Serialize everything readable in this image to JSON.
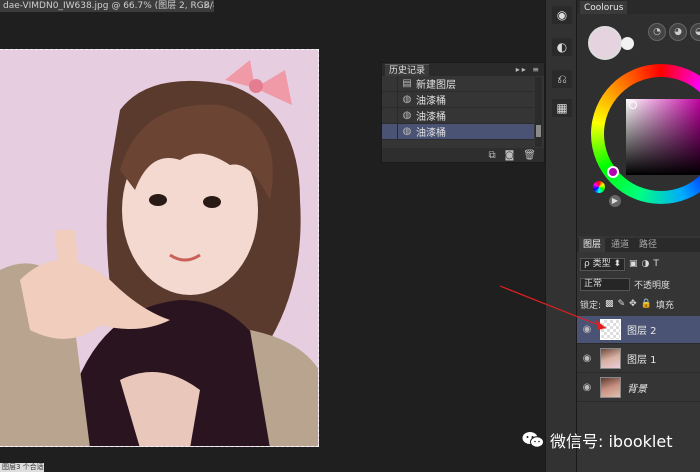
{
  "document_tab": {
    "title": "dae-VIMDN0_IW638.jpg @ 66.7% (图层 2, RGB/8*)",
    "close_icon": "close-icon"
  },
  "status_bar": {
    "text": "图层3 个合适"
  },
  "history_panel": {
    "tab_label": "历史记录",
    "items": [
      {
        "label": "新建图层",
        "icon": "document-icon"
      },
      {
        "label": "油漆桶",
        "icon": "paint-bucket-icon"
      },
      {
        "label": "油漆桶",
        "icon": "paint-bucket-icon"
      },
      {
        "label": "油漆桶",
        "icon": "paint-bucket-icon",
        "active": true
      }
    ]
  },
  "coolorus": {
    "tab_label": "Coolorus",
    "foreground_color": "#e6d3e0",
    "background_color": "#f2f2f2"
  },
  "layers_panel": {
    "tabs": [
      "图层",
      "通道",
      "路径"
    ],
    "filter_kind": "ρ 类型",
    "blend_mode": "正常",
    "opacity_label": "不透明度",
    "lock_label": "锁定:",
    "fill_label": "填充",
    "layers": [
      {
        "name": "图层 2",
        "active": true,
        "thumb": "transparent"
      },
      {
        "name": "图层 1",
        "active": false,
        "thumb": "photo"
      },
      {
        "name": "背景",
        "active": false,
        "thumb": "photo",
        "italic": true
      }
    ]
  },
  "watermark": {
    "text": "微信号: ibooklet"
  },
  "colors": {
    "canvas_bg": "#1f1f1f",
    "panel_bg": "#353535",
    "selection_highlight": "#4b5374",
    "photo_bg": "#e6cde0"
  }
}
